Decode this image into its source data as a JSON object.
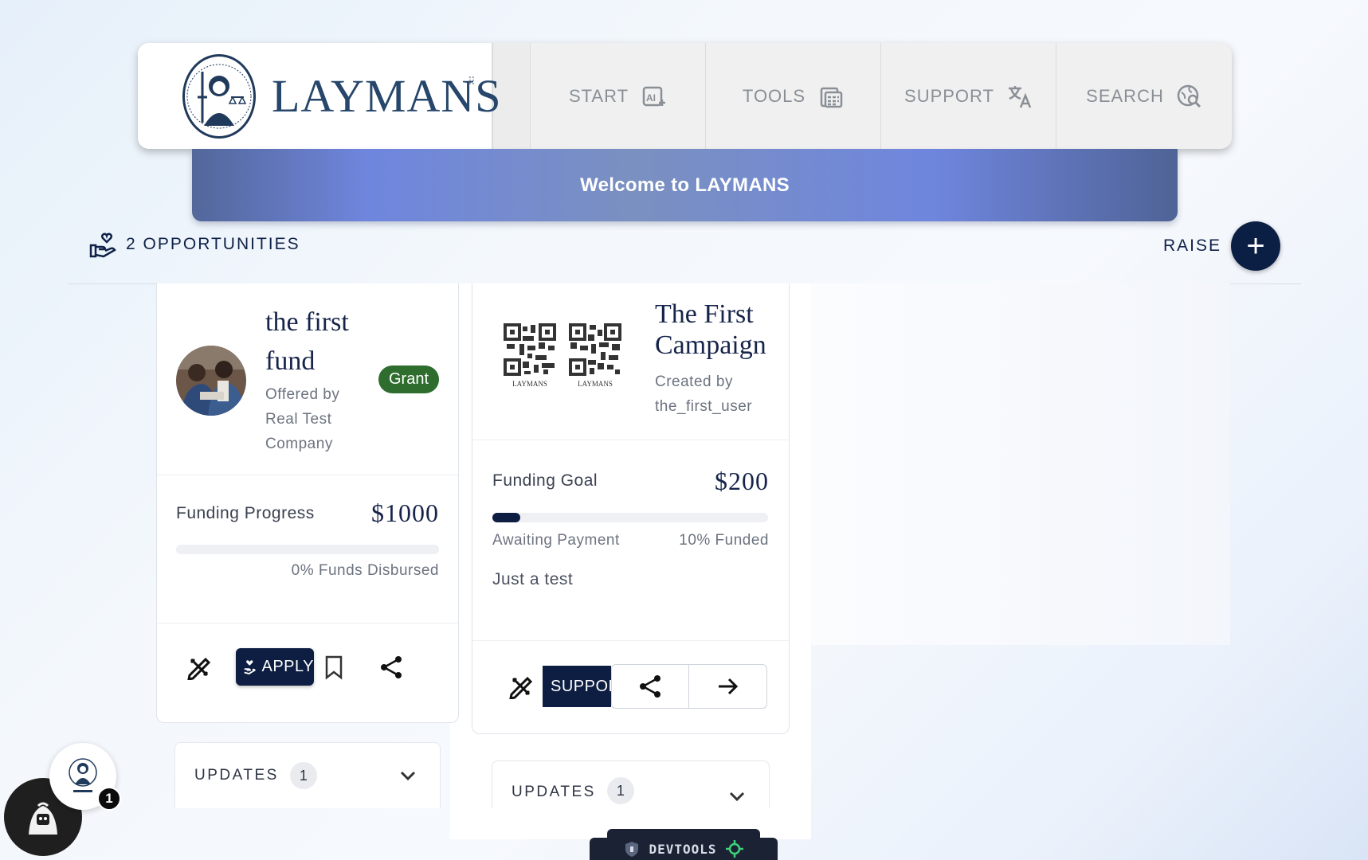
{
  "header": {
    "brand_name": "LAYMANS",
    "nav": [
      {
        "label": "START",
        "icon": "ai-sparkle-icon"
      },
      {
        "label": "TOOLS",
        "icon": "calculator-icon"
      },
      {
        "label": "SUPPORT",
        "icon": "translate-icon"
      },
      {
        "label": "SEARCH",
        "icon": "globe-search-icon"
      }
    ]
  },
  "banner": {
    "text": "Welcome to LAYMANS"
  },
  "toolbar": {
    "opportunities_label": "2 OPPORTUNITIES",
    "raise_label": "RAISE",
    "raise_button": "+"
  },
  "cards": [
    {
      "title_line1": "the first",
      "title_line2": "fund",
      "offered_line1": "Offered by",
      "offered_line2": "Real Test",
      "offered_line3": "Company",
      "badge": "Grant",
      "progress_label": "Funding Progress",
      "amount": "$1000",
      "progress_fraction": 0,
      "disbursed": "0% Funds Disbursed",
      "apply_label": "APPLY",
      "updates_label": "UPDATES",
      "updates_count": "1"
    },
    {
      "title_line1": "The First",
      "title_line2": "Campaign",
      "created_line1": "Created by",
      "created_line2": "the_first_user",
      "qr_caption_1": "LAYMANS",
      "qr_caption_2": "LAYMANS",
      "goal_label": "Funding Goal",
      "amount": "$200",
      "progress_fraction": 0.1,
      "status": "Awaiting Payment",
      "funded": "10% Funded",
      "description": "Just a test",
      "support_label": "SUPPORT",
      "updates_label": "UPDATES",
      "updates_count": "1"
    }
  ],
  "widgets": {
    "notification_count": "1",
    "devtools_label": "DEVTOOLS"
  },
  "colors": {
    "navy": "#0d1e42",
    "grant_green": "#2e6d2e",
    "banner_accent": "#6f86de"
  }
}
